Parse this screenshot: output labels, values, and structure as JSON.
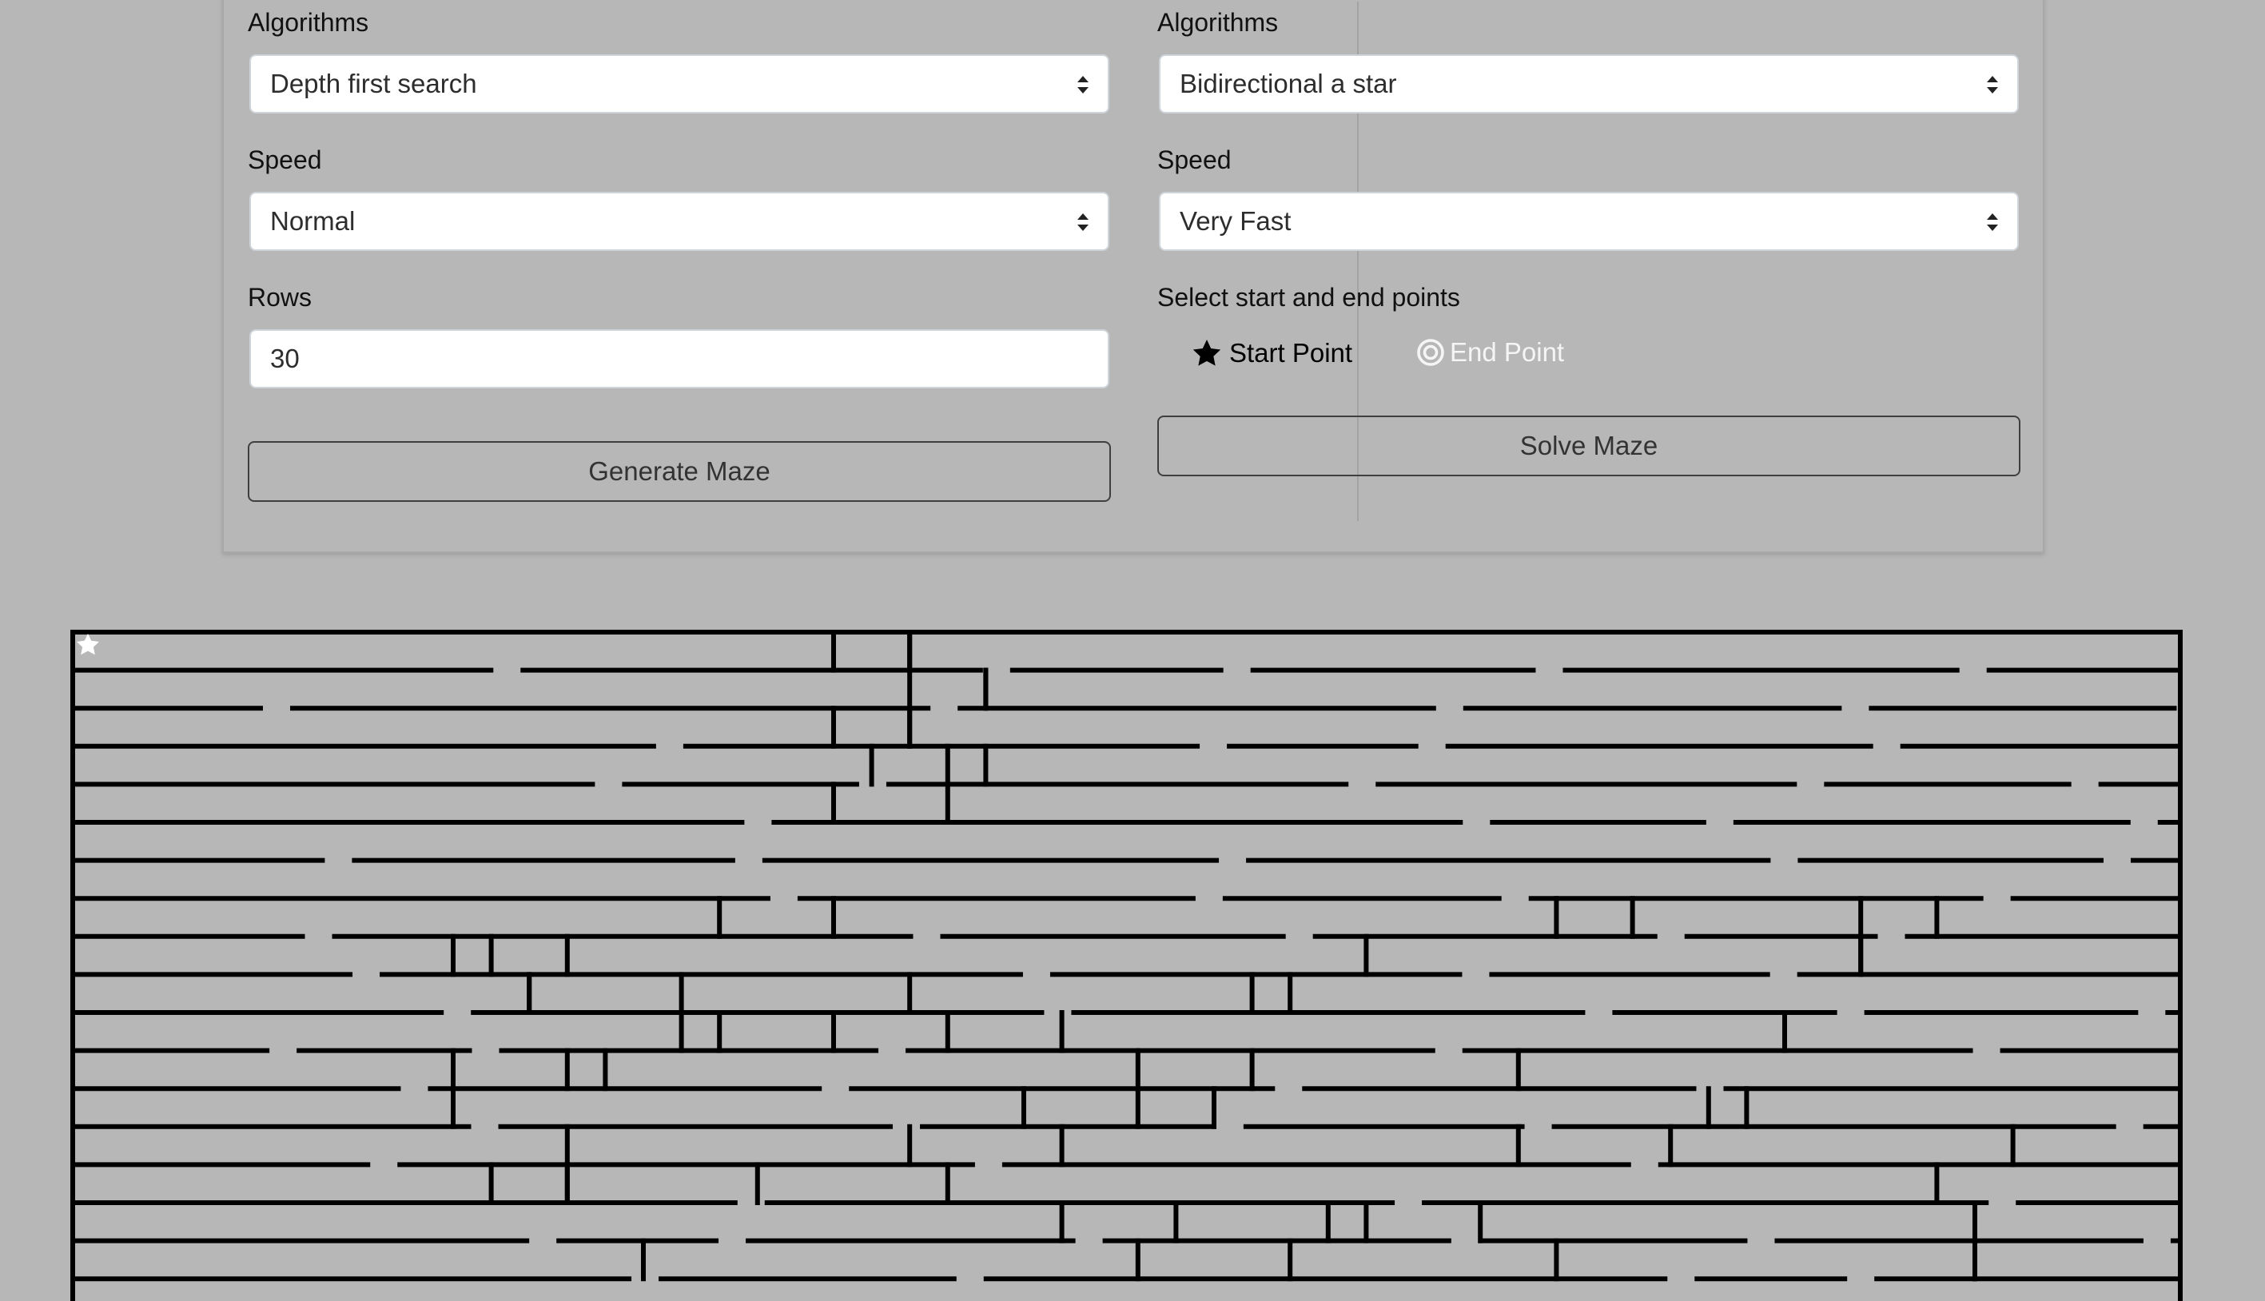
{
  "left_panel": {
    "algorithm_label": "Algorithms",
    "algorithm_value": "Depth first search",
    "speed_label": "Speed",
    "speed_value": "Normal",
    "rows_label": "Rows",
    "rows_value": "30",
    "generate_button": "Generate Maze"
  },
  "right_panel": {
    "algorithm_label": "Algorithms",
    "algorithm_value": "Bidirectional a star",
    "speed_label": "Speed",
    "speed_value": "Very Fast",
    "points_label": "Select start and end points",
    "start_point_label": "Start Point",
    "end_point_label": "End Point",
    "solve_button": "Solve Maze"
  },
  "maze": {
    "rows": 30,
    "wall_color": "#000000",
    "background_color": "#b7b7b7",
    "start_marker_icon": "star-icon",
    "end_marker_icon": "target-icon"
  },
  "colors": {
    "active_point": "#000000",
    "inactive_point": "#f5f5f5"
  }
}
